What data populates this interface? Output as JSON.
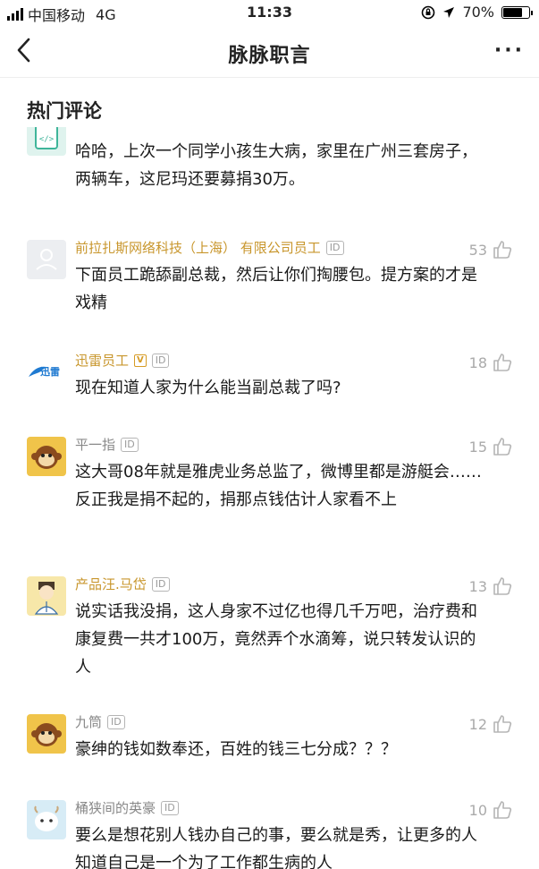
{
  "status_bar": {
    "carrier": "中国移动",
    "network": "4G",
    "time": "11:33",
    "battery": "70%"
  },
  "nav": {
    "title": "脉脉职言",
    "more": "···"
  },
  "section": {
    "title": "热门评论"
  },
  "comments": [
    {
      "name": "",
      "text": "哈哈，上次一个同学小孩生大病，家里在广州三套房子，两辆车，这尼玛还要募捐30万。",
      "likes": "",
      "avatar": "code-avatar"
    },
    {
      "name": "前拉扎斯网络科技（上海） 有限公司员工",
      "text": "下面员工跪舔副总裁，然后让你们掏腰包。提方案的才是戏精",
      "likes": "53",
      "avatar": "default-avatar"
    },
    {
      "name": "迅雷员工",
      "v_badge": "V",
      "text": "现在知道人家为什么能当副总裁了吗?",
      "likes": "18",
      "avatar": "xunlei-logo"
    },
    {
      "name": "平一指",
      "text": "这大哥08年就是雅虎业务总监了，微博里都是游艇会……反正我是捐不起的，捐那点钱估计人家看不上",
      "likes": "15",
      "avatar": "monkey-avatar"
    },
    {
      "name": "产品汪.马岱",
      "text": "说实话我没捐，这人身家不过亿也得几千万吧，治疗费和康复费一共才100万，竟然弄个水滴筹，说只转发认识的人",
      "likes": "13",
      "avatar": "product-avatar"
    },
    {
      "name": "九筒",
      "text": "豪绅的钱如数奉还，百姓的钱三七分成？？？",
      "likes": "12",
      "avatar": "monkey-avatar"
    },
    {
      "name": "桶狭间的英豪",
      "text": "要么是想花别人钱办自己的事，要么就是秀，让更多的人知道自己是一个为了工作都生病的人",
      "likes": "10",
      "avatar": "goat-avatar"
    }
  ],
  "id_badge_label": "ID",
  "colors": {
    "name": "#c8962c",
    "text": "#1a1a1a",
    "likes": "#aaaaaa"
  }
}
